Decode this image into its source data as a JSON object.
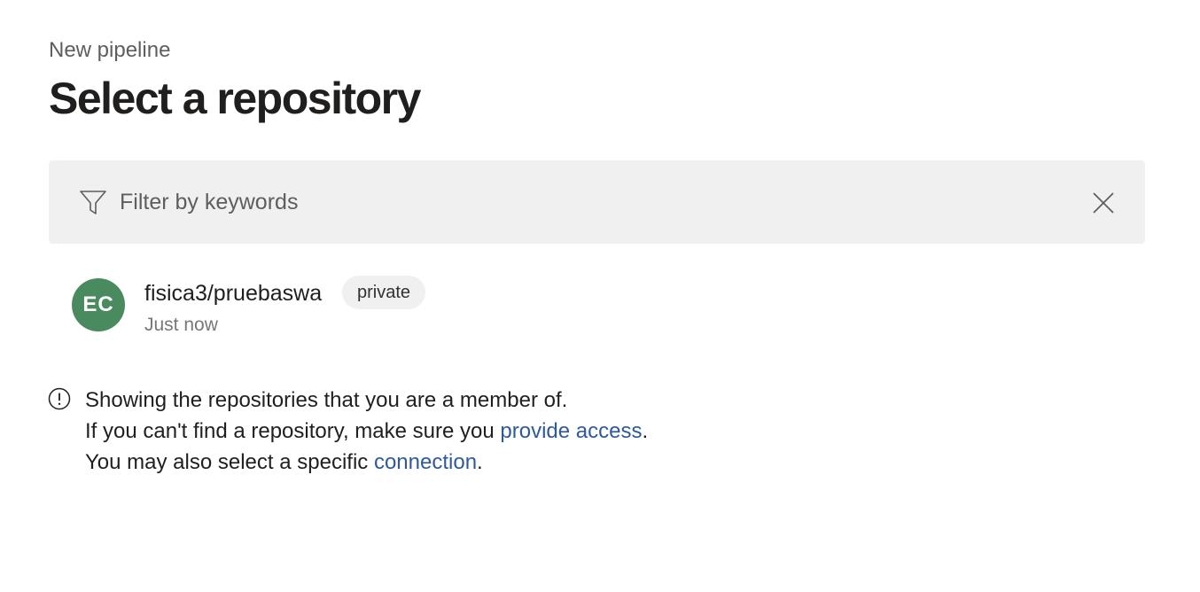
{
  "header": {
    "eyebrow": "New pipeline",
    "title": "Select a repository"
  },
  "filter": {
    "placeholder": "Filter by keywords",
    "value": "",
    "icon": "filter-icon",
    "clear_icon": "close-icon"
  },
  "repositories": [
    {
      "avatar_initials": "EC",
      "avatar_color": "#4a8a5f",
      "name": "fisica3/pruebaswa",
      "visibility": "private",
      "updated": "Just now"
    }
  ],
  "info": {
    "icon": "info-icon",
    "line1": "Showing the repositories that you are a member of.",
    "line2_prefix": "If you can't find a repository, make sure you ",
    "line2_link": "provide access",
    "line2_suffix": ".",
    "line3_prefix": "You may also select a specific ",
    "line3_link": "connection",
    "line3_suffix": "."
  },
  "colors": {
    "link": "#2e5a9c",
    "filter_background": "#f0f0f0",
    "badge_background": "#f0f0f0",
    "muted_text": "#605e5c"
  }
}
